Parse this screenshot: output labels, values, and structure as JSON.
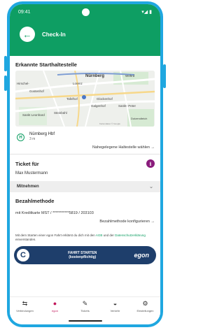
{
  "statusbar": {
    "time": "09:41",
    "icons": "▾◢ ▮"
  },
  "header": {
    "title": "Check-In",
    "back_icon": "arrow-left-icon"
  },
  "start_stop": {
    "section_title": "Erkannte Starthaltestelle",
    "map_labels": {
      "nurnberg": "Nürnberg",
      "wohrd": "Wöhrd",
      "lorenz": "Lorenz",
      "hirsche": "Hirschel-",
      "gostenhof": "Gostenhof",
      "tafelhof": "Tafelhof",
      "glockenhof": "Glockenhof",
      "galgenhof": "Galgenhof",
      "sankt_peter": "Sankt-\nPeter",
      "sankt_leonhard": "Sankt\nLeonhard",
      "steinbuhl": "Steinbühl",
      "dutzendteich": "Dutzendteich",
      "attribution": "Kartendaten © Google"
    },
    "station_name": "Nürnberg Hbf",
    "station_distance": "3 m",
    "nearest_link": "Nahegelegene Haltestelle wählen →"
  },
  "ticket": {
    "section_title": "Ticket für",
    "holder": "Max Mustermann",
    "info_icon": "i"
  },
  "mitnehmen": {
    "label": "Mitnehmen",
    "chevron": "⌄"
  },
  "payment": {
    "section_title": "Bezahlmethode",
    "method": "mit Kreditkarte MST / ***********5819 / 203103",
    "configure_link": "Bezahlmethode konfigurieren →"
  },
  "notice": {
    "text_before": "Mit dem Starten einer egon Fahrt erklärst du dich mit den",
    "agb_link": "AGB",
    "text_middle": "und der",
    "privacy_link": "Datenschutzerklärung",
    "text_after": "einverstanden."
  },
  "start_button": {
    "line1": "FAHRT STARTEN",
    "line2": "(kostenpflichtig)",
    "brand": "egon"
  },
  "nav": [
    {
      "label": "Verbindungen",
      "icon": "⇆",
      "icon_name": "connections-icon"
    },
    {
      "label": "egon",
      "icon": "●",
      "icon_name": "egon-icon"
    },
    {
      "label": "Tickets",
      "icon": "✎",
      "icon_name": "ticket-icon"
    },
    {
      "label": "Verkehr",
      "icon": "◒",
      "icon_name": "traffic-icon"
    },
    {
      "label": "Einstellungen",
      "icon": "⚙",
      "icon_name": "settings-icon"
    }
  ],
  "colors": {
    "primary_green": "#0e9e63",
    "egon_navy": "#1e3e6b",
    "accent_purple": "#8a1c7c",
    "active_nav": "#c2185b",
    "frame_blue": "#1fa7e0"
  }
}
